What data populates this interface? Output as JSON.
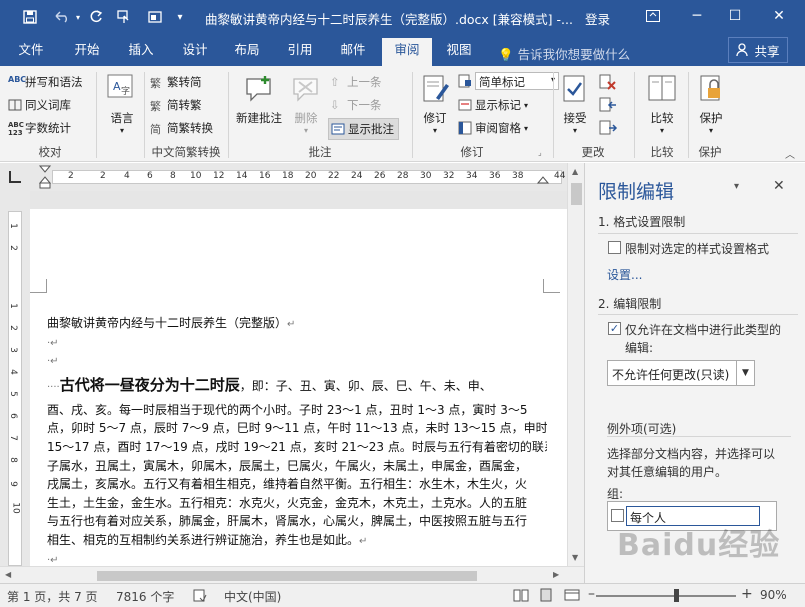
{
  "window": {
    "title": "曲黎敏讲黄帝内经与十二时辰养生（完整版）.docx [兼容模式] -...",
    "login": "登录",
    "minimize": "─",
    "restore": "☐",
    "close": "✕"
  },
  "tabs": [
    {
      "label": "文件"
    },
    {
      "label": "开始"
    },
    {
      "label": "插入"
    },
    {
      "label": "设计"
    },
    {
      "label": "布局"
    },
    {
      "label": "引用"
    },
    {
      "label": "邮件"
    },
    {
      "label": "审阅"
    },
    {
      "label": "视图"
    }
  ],
  "active_tab": "审阅",
  "tell_me": "告诉我你想要做什么",
  "share": "共享",
  "ribbon": {
    "proofing": {
      "label": "校对",
      "spelling": "拼写和语法",
      "thesaurus": "同义词库",
      "wordcount": "字数统计"
    },
    "language": {
      "label": "语言"
    },
    "chinese": {
      "label": "中文简繁转换",
      "to_trad": "繁转简",
      "to_simp": "简转繁",
      "convert": "简繁转换"
    },
    "comments": {
      "label": "批注",
      "new": "新建批注",
      "delete": "删除",
      "prev": "上一条",
      "next": "下一条",
      "show": "显示批注"
    },
    "tracking": {
      "label": "修订",
      "track": "修订",
      "markup": "简单标记",
      "show_markup": "显示标记",
      "pane": "审阅窗格"
    },
    "changes": {
      "label": "更改",
      "accept": "接受"
    },
    "compare": {
      "label": "比较",
      "compare": "比较"
    },
    "protect": {
      "label": "保护",
      "protect": "保护"
    }
  },
  "ruler_numbers": [
    "2",
    "2",
    "4",
    "6",
    "8",
    "10",
    "12",
    "14",
    "16",
    "18",
    "20",
    "22",
    "24",
    "26",
    "28",
    "30",
    "32",
    "34",
    "36",
    "38",
    "40",
    "42",
    "44"
  ],
  "vruler_numbers": [
    "1",
    "2",
    "1",
    "2",
    "3",
    "4",
    "5",
    "6",
    "7",
    "8",
    "9",
    "10"
  ],
  "document": {
    "title_line": "曲黎敏讲黄帝内经与十二时辰养生（完整版）",
    "heading_lead": "····",
    "heading": "古代将一昼夜分为十二时辰",
    "heading_rest": "，即：子、丑、寅、卯、辰、巳、午、未、申、",
    "para1": [
      "酉、戌、亥。每一时辰相当于现代的两个小时。子时 23～1 点，丑时 1～3 点，寅时 3～5",
      "点，卯时 5～7 点，辰时 7～9 点，巳时 9～11 点，午时 11～13 点，未时 13～15 点，申时",
      "15～17 点，酉时 17～19 点，戌时 19～21 点，亥时 21～23 点。时辰与五行有着密切的联系。",
      "子属水，丑属土，寅属木，卯属木，辰属土，巳属火，午属火，未属土，申属金，酉属金，",
      "戌属土，亥属水。五行又有着相生相克，维持着自然平衡。五行相生：水生木，木生火，火",
      "生土，土生金，金生水。五行相克：水克火，火克金，金克木，木克土，土克水。人的五脏",
      "与五行也有着对应关系，肺属金，肝属木，肾属水，心属火，脾属土，中医按照五脏与五行",
      "相生、相克的互相制约关系进行辨证施治，养生也是如此。"
    ]
  },
  "pane": {
    "title": "限制编辑",
    "section1": "1. 格式设置限制",
    "format_restrict": "限制对选定的样式设置格式",
    "settings": "设置...",
    "section2": "2. 编辑限制",
    "allow_only_1": "仅允许在文档中进行此类型的",
    "allow_only_2": "编辑:",
    "edit_type": "不允许任何更改(只读)",
    "exceptions": "例外项(可选)",
    "exceptions_desc_1": "选择部分文档内容，并选择可以",
    "exceptions_desc_2": "对其任意编辑的用户。",
    "group_label": "组:",
    "everyone": "每个人",
    "watermark": "Baidu经验"
  },
  "status": {
    "page": "第 1 页，共 7 页",
    "words": "7816 个字",
    "language": "中文(中国)",
    "zoom": "90%"
  }
}
